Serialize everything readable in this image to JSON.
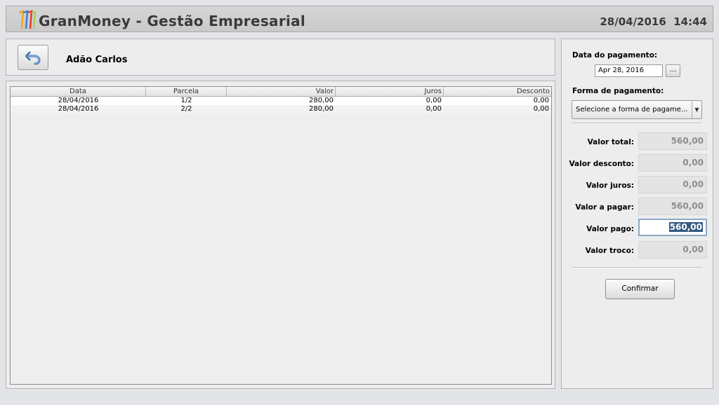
{
  "header": {
    "app_title": "GranMoney - Gestão Empresarial",
    "date_time": "28/04/2016  14:44",
    "logo_colors": [
      "#f2a21e",
      "#3a7fd0",
      "#e53935"
    ]
  },
  "client": {
    "back_icon": "back-arrow-icon",
    "name": "Adão Carlos"
  },
  "table": {
    "columns": [
      "Data",
      "Parcela",
      "Valor",
      "Juros",
      "Desconto"
    ],
    "rows": [
      [
        "28/04/2016",
        "1/2",
        "280,00",
        "0,00",
        "0,00"
      ],
      [
        "28/04/2016",
        "2/2",
        "280,00",
        "0,00",
        "0,00"
      ]
    ]
  },
  "payment": {
    "date_label": "Data do pagamento:",
    "date_value": "Apr 28, 2016",
    "date_button": "...",
    "method_label": "Forma de pagamento:",
    "method_value": "Selecione a forma de pagame...",
    "method_arrow_icon": "dropdown-arrow-icon"
  },
  "summary": [
    {
      "key": "valor-total",
      "label": "Valor total:",
      "value": "560,00"
    },
    {
      "key": "valor-desconto",
      "label": "Valor desconto:",
      "value": "0,00"
    },
    {
      "key": "valor-juros",
      "label": "Valor juros:",
      "value": "0,00"
    },
    {
      "key": "valor-a-pagar",
      "label": "Valor a pagar:",
      "value": "560,00"
    },
    {
      "key": "valor-pago",
      "label": "Valor pago:",
      "value": "560,00"
    },
    {
      "key": "valor-troco",
      "label": "Valor troco:",
      "value": "0,00"
    }
  ],
  "confirm_label": "Confirmar"
}
